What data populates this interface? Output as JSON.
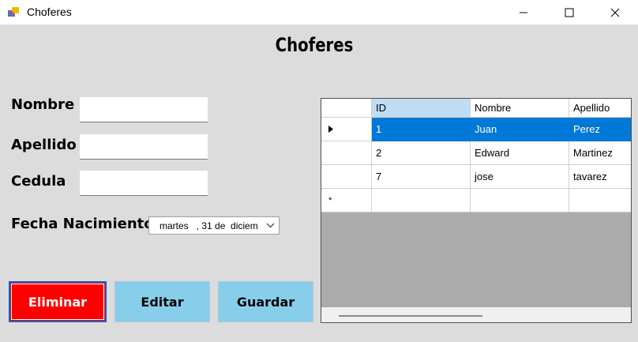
{
  "window": {
    "title": "Choferes",
    "icon": "winforms-app-icon",
    "controls": {
      "minimize": "minimize-icon",
      "maximize": "maximize-icon",
      "close": "close-icon"
    }
  },
  "form": {
    "heading": "Choferes",
    "labels": {
      "nombre": "Nombre",
      "apellido": "Apellido",
      "cedula": "Cedula",
      "fecha": "Fecha Nacimiento"
    },
    "fields": {
      "nombre": "",
      "apellido": "",
      "cedula": ""
    },
    "date_value": "martes   , 31 de  diciem",
    "buttons": {
      "eliminar": "Eliminar",
      "editar": "Editar",
      "guardar": "Guardar"
    }
  },
  "grid": {
    "columns": [
      "ID",
      "Nombre",
      "Apellido"
    ],
    "rows": [
      {
        "id": "1",
        "nombre": "Juan",
        "apellido": "Perez",
        "selected": true
      },
      {
        "id": "2",
        "nombre": "Edward",
        "apellido": "Martinez",
        "selected": false
      },
      {
        "id": "7",
        "nombre": "jose",
        "apellido": "tavarez",
        "selected": false
      }
    ],
    "new_row_marker": "*"
  },
  "colors": {
    "eliminar_bg": "#ff0000",
    "button_bg": "#87ceeb",
    "selection": "#0078d7",
    "client_bg": "#dcdcdc"
  }
}
